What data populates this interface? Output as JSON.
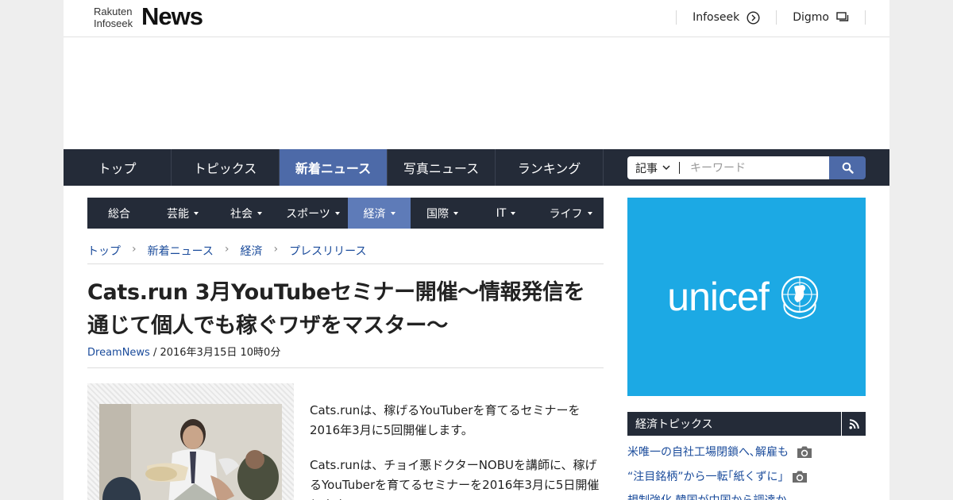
{
  "header": {
    "logo_top": "Rakuten",
    "logo_bottom": "Infoseek",
    "logo_main": "News",
    "links": [
      {
        "label": "Infoseek",
        "icon": "circle-arrow-icon"
      },
      {
        "label": "Digmo",
        "icon": "windows-icon"
      }
    ]
  },
  "global_nav": {
    "items": [
      "トップ",
      "トピックス",
      "新着ニュース",
      "写真ニュース",
      "ランキング"
    ],
    "active": "新着ニュース"
  },
  "search": {
    "select_value": "記事",
    "placeholder": "キーワード",
    "button_icon": "search-icon"
  },
  "category_nav": {
    "items": [
      "総合",
      "芸能",
      "社会",
      "スポーツ",
      "経済",
      "国際",
      "IT",
      "ライフ"
    ],
    "active": "経済"
  },
  "breadcrumb": [
    "トップ",
    "新着ニュース",
    "経済",
    "プレスリリース"
  ],
  "article": {
    "title": "Cats.run 3月YouTubeセミナー開催～情報発信を通じて個人でも稼ぐワザをマスター～",
    "source": "DreamNews",
    "date": " / 2016年3月15日 10時0分",
    "para1": "Cats.runは、稼げるYouTuberを育てるセミナーを2016年3月に5回開催します。",
    "para2": "Cats.runは、チョイ悪ドクターNOBUを講師に、稼げるYouTuberを育てるセミナーを2016年3月に5日開催します。"
  },
  "sidebar": {
    "banner_text": "unicef",
    "banner_color": "#1ca9e4",
    "topics_title": "経済トピックス",
    "topics": [
      {
        "title": "米唯一の自社工場閉鎖へ､解雇も",
        "has_photo": true
      },
      {
        "title": "“注目銘柄”から一転｢紙くずに｣",
        "has_photo": true
      },
      {
        "title": "規制強化 韓国が中国から調達か",
        "has_photo": false
      }
    ]
  },
  "colors": {
    "nav_dark": "#242b38",
    "nav_active": "#4d6aa8",
    "category_active": "#5e7bb8",
    "link": "#1a4b9b"
  }
}
